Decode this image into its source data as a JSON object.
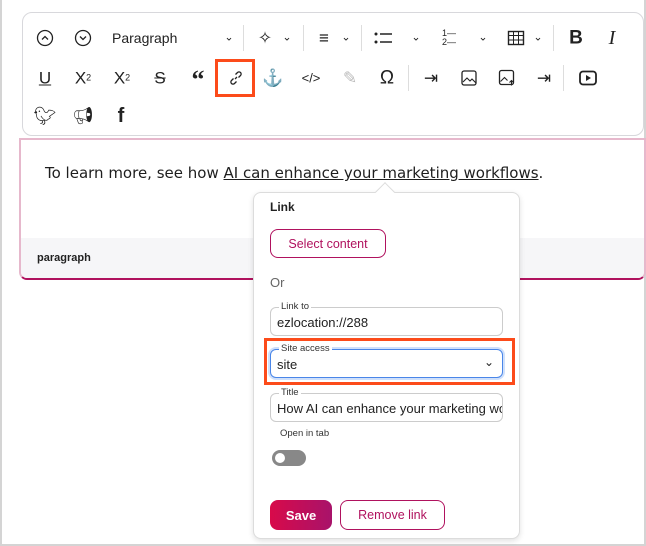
{
  "toolbar": {
    "block_style": "Paragraph",
    "row1": [
      "chevron-up-circle-icon",
      "chevron-down-circle-icon",
      "ai-sparkle-icon",
      "align-left-icon",
      "bulleted-list-icon",
      "numbered-list-icon",
      "table-icon",
      "bold-icon",
      "italic-icon"
    ],
    "row2": [
      "underline-icon",
      "subscript-icon",
      "superscript-icon",
      "strikethrough-icon",
      "blockquote-icon",
      "link-icon",
      "anchor-icon",
      "code-icon",
      "edit-icon",
      "special-characters-icon",
      "embed-icon",
      "image-icon",
      "upload-image-icon",
      "embed-inline-icon",
      "video-icon"
    ],
    "row3": [
      "twitter-icon",
      "megaphone-icon",
      "facebook-icon"
    ],
    "highlight_color": "#fc4b1a"
  },
  "editor": {
    "text_before": "To learn more, see how ",
    "link_text": "AI can enhance your marketing workflows",
    "text_after": ".",
    "element_path": "paragraph"
  },
  "link_popup": {
    "title": "Link",
    "select_content": "Select content",
    "or": "Or",
    "link_to_label": "Link to",
    "link_to_value": "ezlocation://288",
    "site_access_label": "Site access",
    "site_access_value": "site",
    "title_label": "Title",
    "title_value": "How AI can enhance your marketing workflows",
    "open_in_tab_label": "Open in tab",
    "open_in_tab": false,
    "save": "Save",
    "remove_link": "Remove link",
    "accent_color": "#b0125e"
  }
}
